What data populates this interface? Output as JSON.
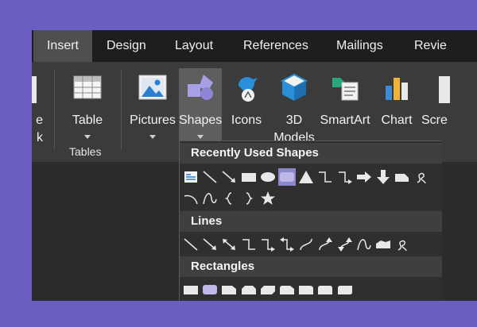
{
  "tabs": [
    "Insert",
    "Design",
    "Layout",
    "References",
    "Mailings",
    "Revie"
  ],
  "ribbon": {
    "cutoff_left": {
      "line1": "e",
      "line2": "k"
    },
    "table": {
      "label": "Table",
      "group": "Tables"
    },
    "pictures": {
      "label": "Pictures"
    },
    "shapes": {
      "label": "Shapes"
    },
    "icons": {
      "label": "Icons"
    },
    "models3d": {
      "label1": "3D",
      "label2": "Models"
    },
    "smartart": {
      "label": "SmartArt"
    },
    "chart": {
      "label": "Chart"
    },
    "screenshot": {
      "label": "Scre"
    }
  },
  "shapes_panel": {
    "sections": [
      "Recently Used Shapes",
      "Lines",
      "Rectangles"
    ],
    "recent": [
      "text-box",
      "line",
      "arrow-line",
      "rectangle",
      "oval",
      "rounded-rectangle",
      "triangle",
      "elbow-connector",
      "elbow-arrow-connector",
      "right-arrow",
      "down-arrow",
      "snip-rectangle",
      "freeform-scribble",
      "arc",
      "curve",
      "left-brace",
      "right-brace",
      "star"
    ],
    "lines": [
      "line",
      "arrow",
      "double-arrow",
      "elbow-connector",
      "elbow-arrow-connector",
      "elbow-double-arrow",
      "curved-connector",
      "curved-arrow-connector",
      "curved-double-arrow",
      "curve",
      "freeform-shape",
      "scribble"
    ],
    "rectangles": [
      "rectangle",
      "rounded-rectangle",
      "snip-single-corner",
      "snip-same-side",
      "snip-diagonal",
      "snip-round-single",
      "round-single-corner",
      "round-same-side",
      "round-diagonal"
    ],
    "selected": "rounded-rectangle"
  },
  "colors": {
    "background": "#6a5ec2",
    "tab_active": "#4f4f4f",
    "ribbon": "#3b3b3b",
    "selection": "#8b88c9"
  }
}
